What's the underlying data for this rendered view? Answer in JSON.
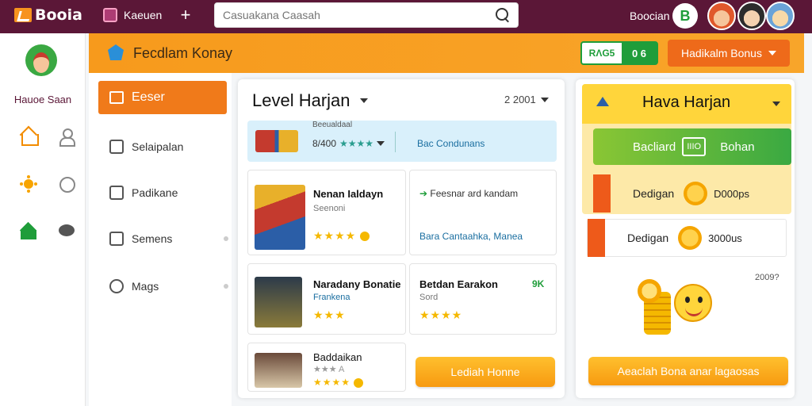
{
  "topbar": {
    "logo": "Booia",
    "nav_label": "Kaeuen",
    "plus": "+",
    "search_placeholder": "Casuakana Caasah",
    "user_name": "Boocian",
    "avatar_letter": "B"
  },
  "leftbar": {
    "title": "Hauoe Saan"
  },
  "header": {
    "title": "Fecdlam Konay",
    "stat_label": "RΛG5",
    "stat_value": "0 6",
    "bonus_button": "Hadikalm Bonus"
  },
  "subnav": {
    "active": "Eeser",
    "items": [
      {
        "label": "Selaipalan"
      },
      {
        "label": "Padikane"
      },
      {
        "label": "Semens"
      },
      {
        "label": "Mags"
      }
    ]
  },
  "main": {
    "title": "Level Harjan",
    "date": "2 2001",
    "banner": {
      "top_text": "Beeualdaal",
      "stat": "8/400",
      "right_text": "Bac Condunans"
    },
    "cards": [
      {
        "title": "Nenan Ialdayn",
        "sub": "Seenoni",
        "stars": "★★★★"
      },
      {
        "title": "Feesnar ard kandam",
        "link": "Bara Cantaahka, Manea"
      },
      {
        "title": "Naradany Bonatie",
        "sub": "Frankena",
        "stars": "★★★"
      },
      {
        "title": "Betdan Earakon",
        "sub": "Sord",
        "price": "9K",
        "stars": "★★★★"
      },
      {
        "title": "Baddaikan",
        "stars_top": "★★★ A",
        "stars": "★★★★"
      }
    ],
    "cta": "Lediah Honne"
  },
  "right": {
    "title": "Hava Harjan",
    "green_btn_left": "Bacliard",
    "green_btn_mid": "IIIO",
    "green_btn_right": "Bohan",
    "rows": [
      {
        "label": "Dedigan",
        "amount": "D000ps"
      },
      {
        "label": "Dedigan",
        "amount": "3000us"
      }
    ],
    "date": "2009?",
    "cta": "Aeaclah Bona anar lagaosas"
  }
}
